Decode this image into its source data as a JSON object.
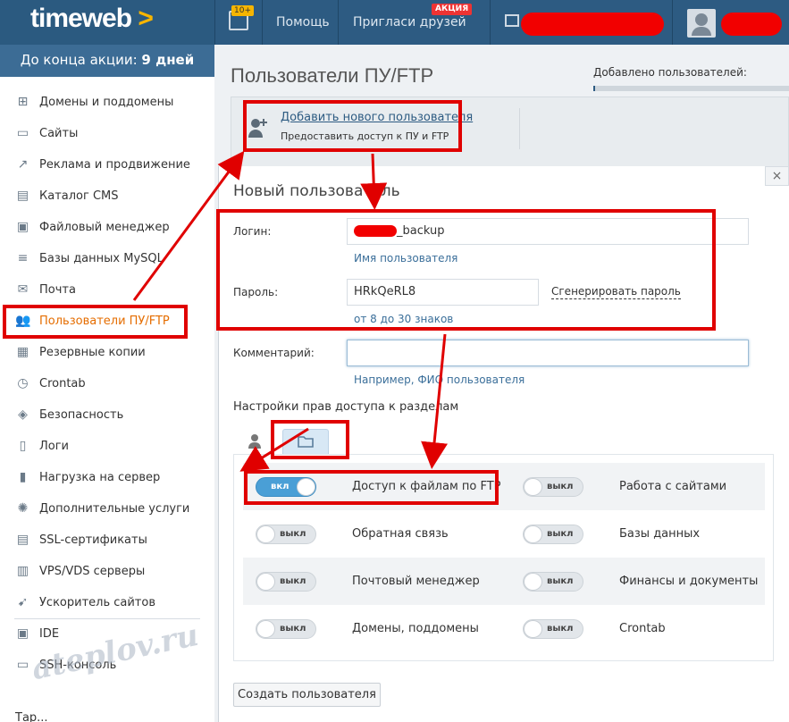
{
  "header": {
    "logo": "timeweb",
    "logo_arrow": ">",
    "notif_badge": "10+",
    "help": "Помощь",
    "invite": "Пригласи друзей",
    "promo_tag": "АКЦИЯ"
  },
  "promo": {
    "text": "До конца акции:",
    "days": "9 дней"
  },
  "sidebar": {
    "items": [
      {
        "label": "Домены и поддомены",
        "icon": "sitemap-icon"
      },
      {
        "label": "Сайты",
        "icon": "browser-icon"
      },
      {
        "label": "Реклама и продвижение",
        "icon": "chart-icon"
      },
      {
        "label": "Каталог CMS",
        "icon": "cms-icon"
      },
      {
        "label": "Файловый менеджер",
        "icon": "folder-icon"
      },
      {
        "label": "Базы данных MySQL",
        "icon": "database-icon"
      },
      {
        "label": "Почта",
        "icon": "mail-icon"
      },
      {
        "label": "Пользователи ПУ/FTP",
        "icon": "users-icon"
      },
      {
        "label": "Резервные копии",
        "icon": "backup-icon"
      },
      {
        "label": "Crontab",
        "icon": "clock-icon"
      },
      {
        "label": "Безопасность",
        "icon": "shield-icon"
      },
      {
        "label": "Логи",
        "icon": "log-icon"
      },
      {
        "label": "Нагрузка на сервер",
        "icon": "load-icon"
      },
      {
        "label": "Дополнительные услуги",
        "icon": "gear-icon"
      },
      {
        "label": "SSL-сертификаты",
        "icon": "certificate-icon"
      },
      {
        "label": "VPS/VDS серверы",
        "icon": "server-icon"
      },
      {
        "label": "Ускоритель сайтов",
        "icon": "rocket-icon"
      },
      {
        "label": "IDE",
        "icon": "ide-icon"
      },
      {
        "label": "SSH-консоль",
        "icon": "terminal-icon"
      }
    ],
    "tail": "Тар..."
  },
  "watermark": "ateplov.ru",
  "main": {
    "title": "Пользователи ПУ/FTP",
    "added_label": "Добавлено пользователей:",
    "added_fraction": 0.01,
    "add_link": "Добавить нового пользователя",
    "add_sub": "Предоставить доступ к ПУ и FTP"
  },
  "modal": {
    "close": "×",
    "title": "Новый пользователь",
    "login_label": "Логин:",
    "login_suffix": "_backup",
    "login_hint": "Имя пользователя",
    "password_label": "Пароль:",
    "password_value": "HRkQeRL8",
    "generate": "Сгенерировать пароль",
    "password_hint": "от 8 до 30 знаков",
    "comment_label": "Комментарий:",
    "comment_value": "",
    "comment_hint": "Например, ФИО пользователя",
    "perms_title": "Настройки прав доступа к разделам",
    "on": "вкл",
    "off": "выкл",
    "perms": [
      {
        "left": "Доступ к файлам по FTP",
        "left_on": true,
        "right": "Работа с сайтами",
        "right_on": false
      },
      {
        "left": "Обратная связь",
        "left_on": false,
        "right": "Базы данных",
        "right_on": false
      },
      {
        "left": "Почтовый менеджер",
        "left_on": false,
        "right": "Финансы и документы",
        "right_on": false
      },
      {
        "left": "Домены, поддомены",
        "left_on": false,
        "right": "Crontab",
        "right_on": false
      }
    ],
    "create_button": "Создать пользователя"
  },
  "colors": {
    "header": "#2d5b82",
    "active": "#e56d00",
    "annotation": "#e00000",
    "toggle_on": "#4a9fd6"
  }
}
